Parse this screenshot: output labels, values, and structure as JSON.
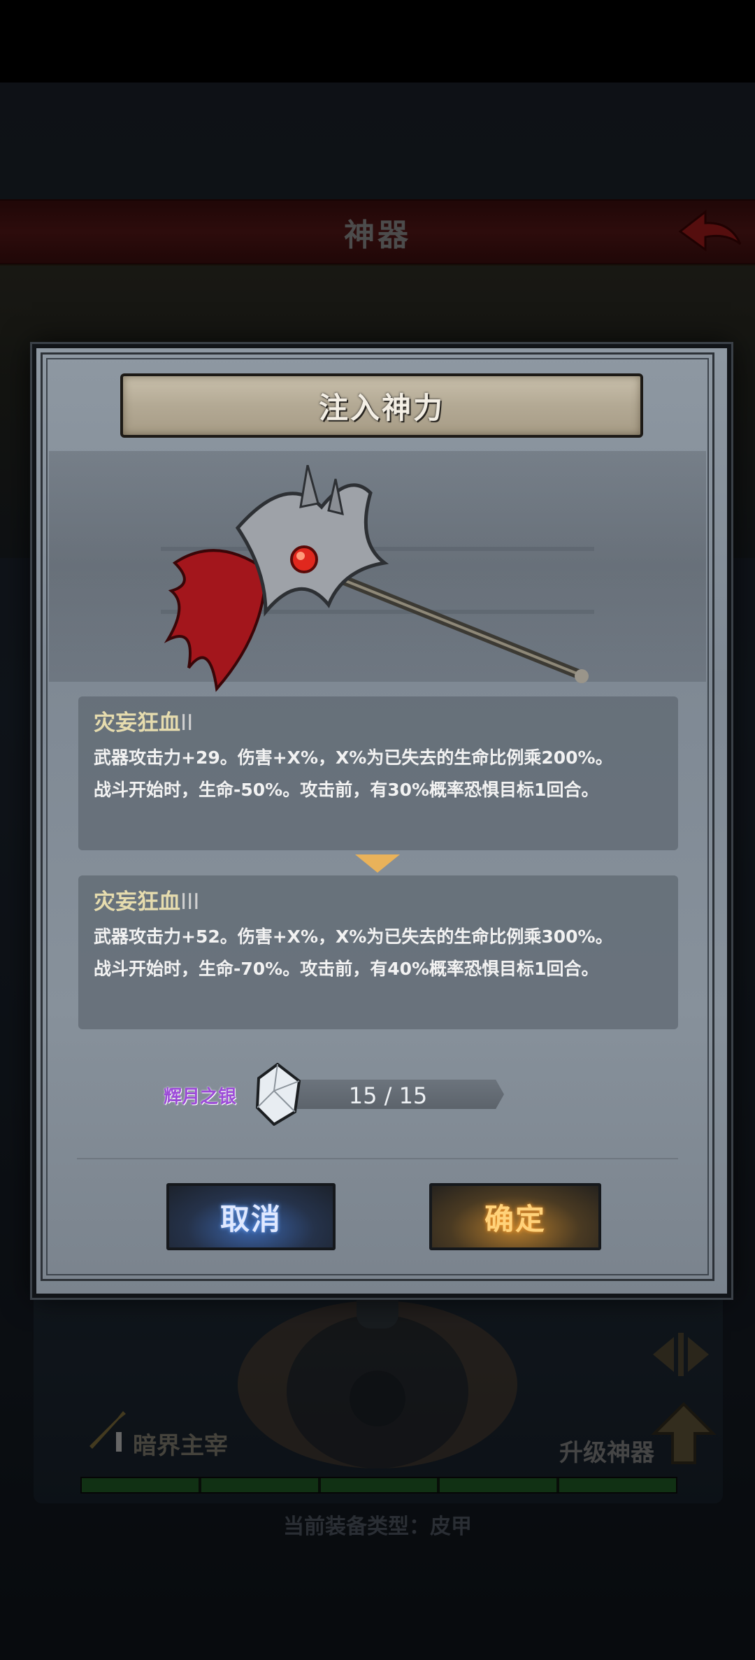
{
  "background_screen": {
    "title": "神器",
    "lord_label": "暗界主宰",
    "upgrade_label": "升级神器",
    "equipment_type": "当前装备类型：皮甲",
    "progress_segments": 5
  },
  "dialog": {
    "title": "注入神力",
    "current": {
      "name": "灾妄狂血",
      "tier": "II",
      "line1": "武器攻击力+29。伤害+X%，X%为已失去的生命比例乘200%。",
      "line2": "战斗开始时，生命-50%。攻击前，有30%概率恐惧目标1回合。"
    },
    "next": {
      "name": "灾妄狂血",
      "tier": "III",
      "line1": "武器攻击力+52。伤害+X%，X%为已失去的生命比例乘300%。",
      "line2": "战斗开始时，生命-70%。攻击前，有40%概率恐惧目标1回合。"
    },
    "material": {
      "name": "辉月之银",
      "count": "15 / 15",
      "icon": "silver-crystal-icon"
    },
    "buttons": {
      "cancel": "取消",
      "confirm": "确定"
    }
  },
  "colors": {
    "accent_gold": "#e6dcae",
    "material_purple": "#9c4bd8",
    "cancel_blue": "#3a63a8",
    "confirm_orange": "#b27a2c"
  }
}
